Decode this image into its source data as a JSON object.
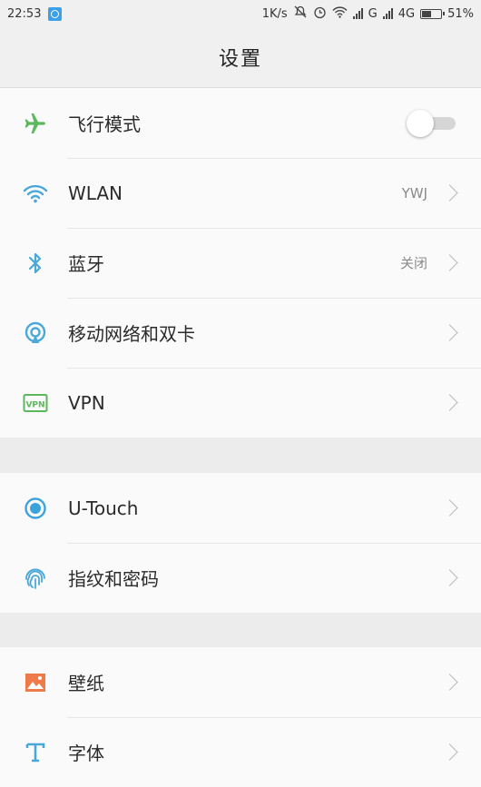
{
  "status_bar": {
    "time": "22:53",
    "speed": "1K/s",
    "network": "G",
    "network2": "4G",
    "battery": "51%"
  },
  "header": {
    "title": "设置"
  },
  "groups": [
    {
      "items": [
        {
          "label": "飞行模式",
          "icon": "airplane-icon",
          "control": "toggle",
          "toggle_on": false,
          "icon_color": "#5cb85c"
        },
        {
          "label": "WLAN",
          "icon": "wifi-icon",
          "value": "YWJ",
          "icon_color": "#4aa8d8"
        },
        {
          "label": "蓝牙",
          "icon": "bluetooth-icon",
          "value": "关闭",
          "icon_color": "#4aa8d8"
        },
        {
          "label": "移动网络和双卡",
          "icon": "mobile-network-icon",
          "icon_color": "#4aa8d8"
        },
        {
          "label": "VPN",
          "icon": "vpn-icon",
          "icon_color": "#5cb85c"
        }
      ]
    },
    {
      "items": [
        {
          "label": "U-Touch",
          "icon": "u-touch-icon",
          "icon_color": "#3aa3dd"
        },
        {
          "label": "指纹和密码",
          "icon": "fingerprint-icon",
          "icon_color": "#4aa8d8"
        }
      ]
    },
    {
      "items": [
        {
          "label": "壁纸",
          "icon": "wallpaper-icon",
          "icon_color": "#f07b4a"
        },
        {
          "label": "字体",
          "icon": "font-icon",
          "icon_color": "#4aa8d8"
        }
      ]
    }
  ]
}
